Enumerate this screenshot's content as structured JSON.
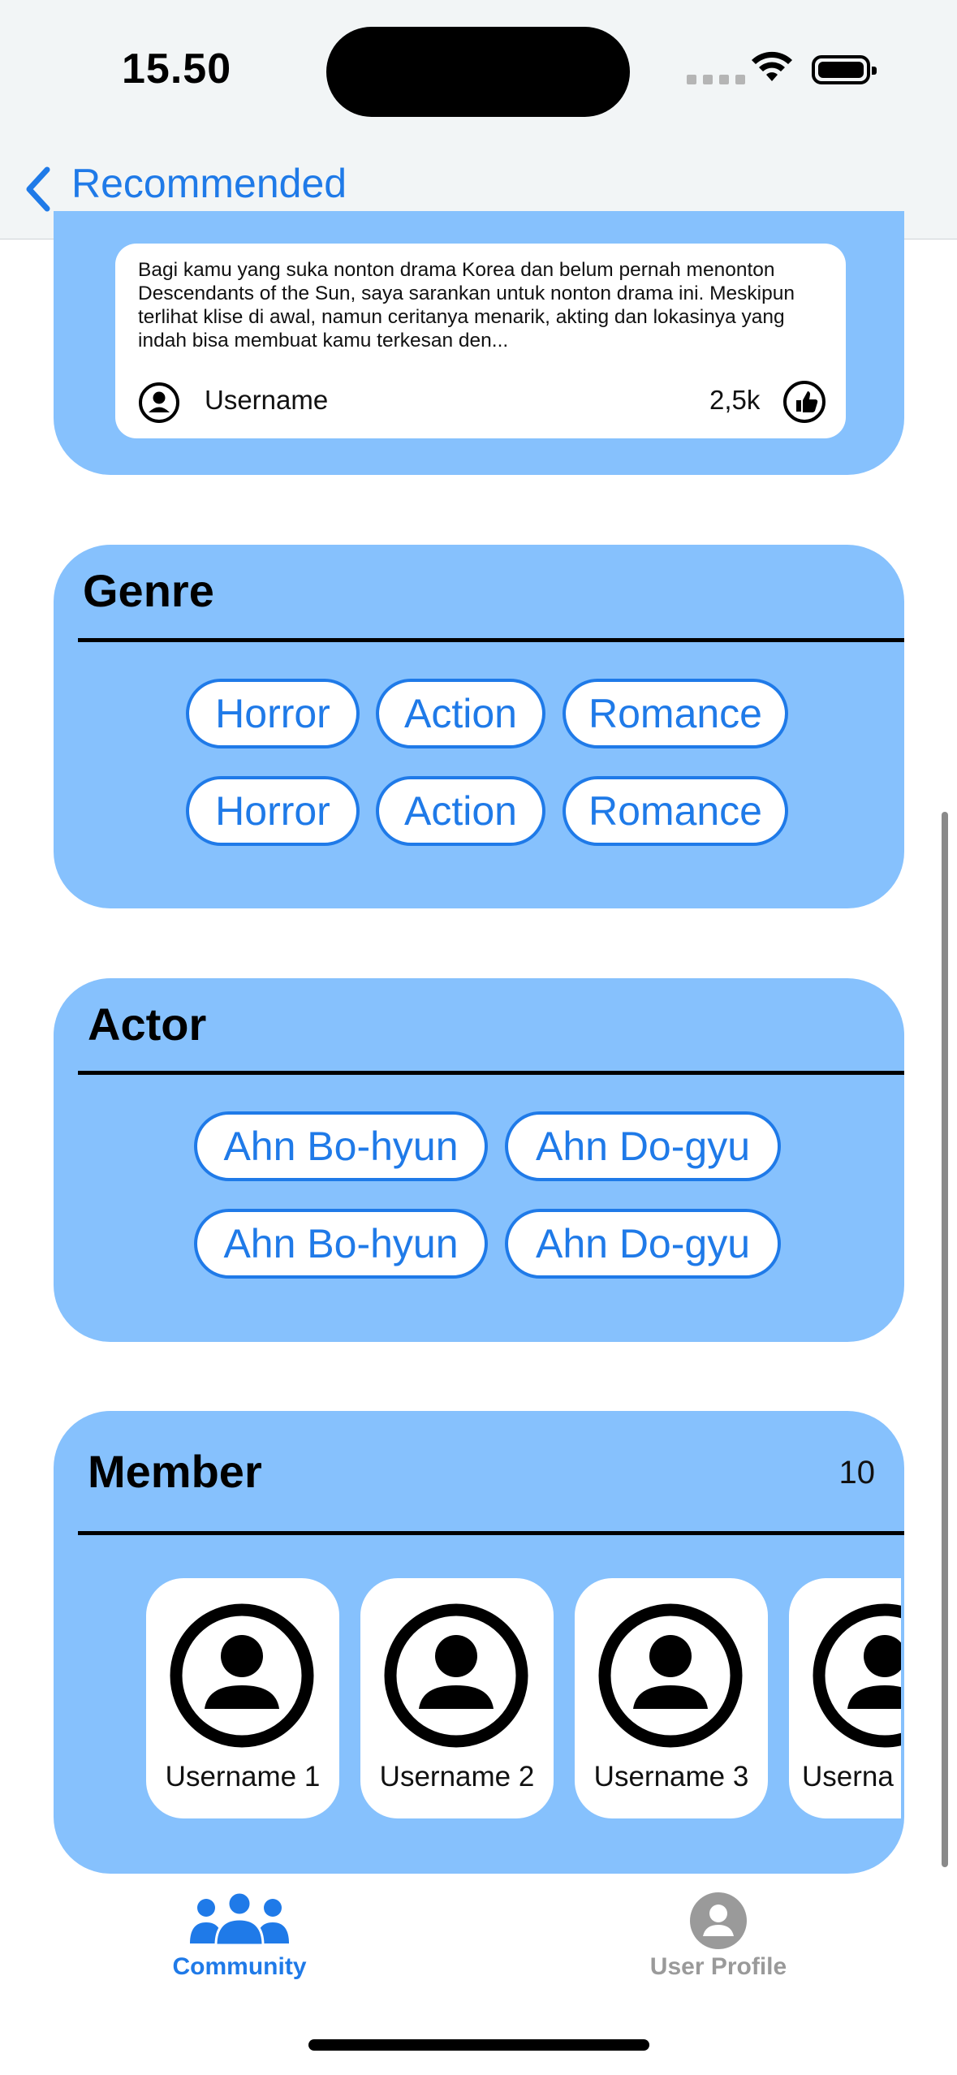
{
  "status_bar": {
    "time": "15.50"
  },
  "nav": {
    "back_label": "Recommended"
  },
  "review": {
    "text": "Bagi kamu yang suka nonton drama Korea dan belum pernah menonton Descendants of the Sun, saya sarankan untuk nonton drama ini. Meskipun terlihat klise di awal, namun ceritanya menarik, akting dan lokasinya yang indah bisa membuat kamu terkesan den...",
    "username": "Username",
    "likes": "2,5k"
  },
  "genre": {
    "title": "Genre",
    "rows": [
      [
        "Horror",
        "Action",
        "Romance"
      ],
      [
        "Horror",
        "Action",
        "Romance"
      ]
    ]
  },
  "actor": {
    "title": "Actor",
    "rows": [
      [
        "Ahn Bo-hyun",
        "Ahn Do-gyu"
      ],
      [
        "Ahn Bo-hyun",
        "Ahn Do-gyu"
      ]
    ]
  },
  "member": {
    "title": "Member",
    "count": "10",
    "items": [
      "Username 1",
      "Username 2",
      "Username 3",
      "Userna"
    ]
  },
  "tabbar": {
    "items": [
      {
        "label": "Community",
        "icon": "community-icon",
        "active": true
      },
      {
        "label": "User Profile",
        "icon": "user-profile-icon",
        "active": false
      }
    ]
  },
  "colors": {
    "accent": "#1f7ae8",
    "card": "#86c1fd",
    "inactive": "#9a9a9a"
  }
}
